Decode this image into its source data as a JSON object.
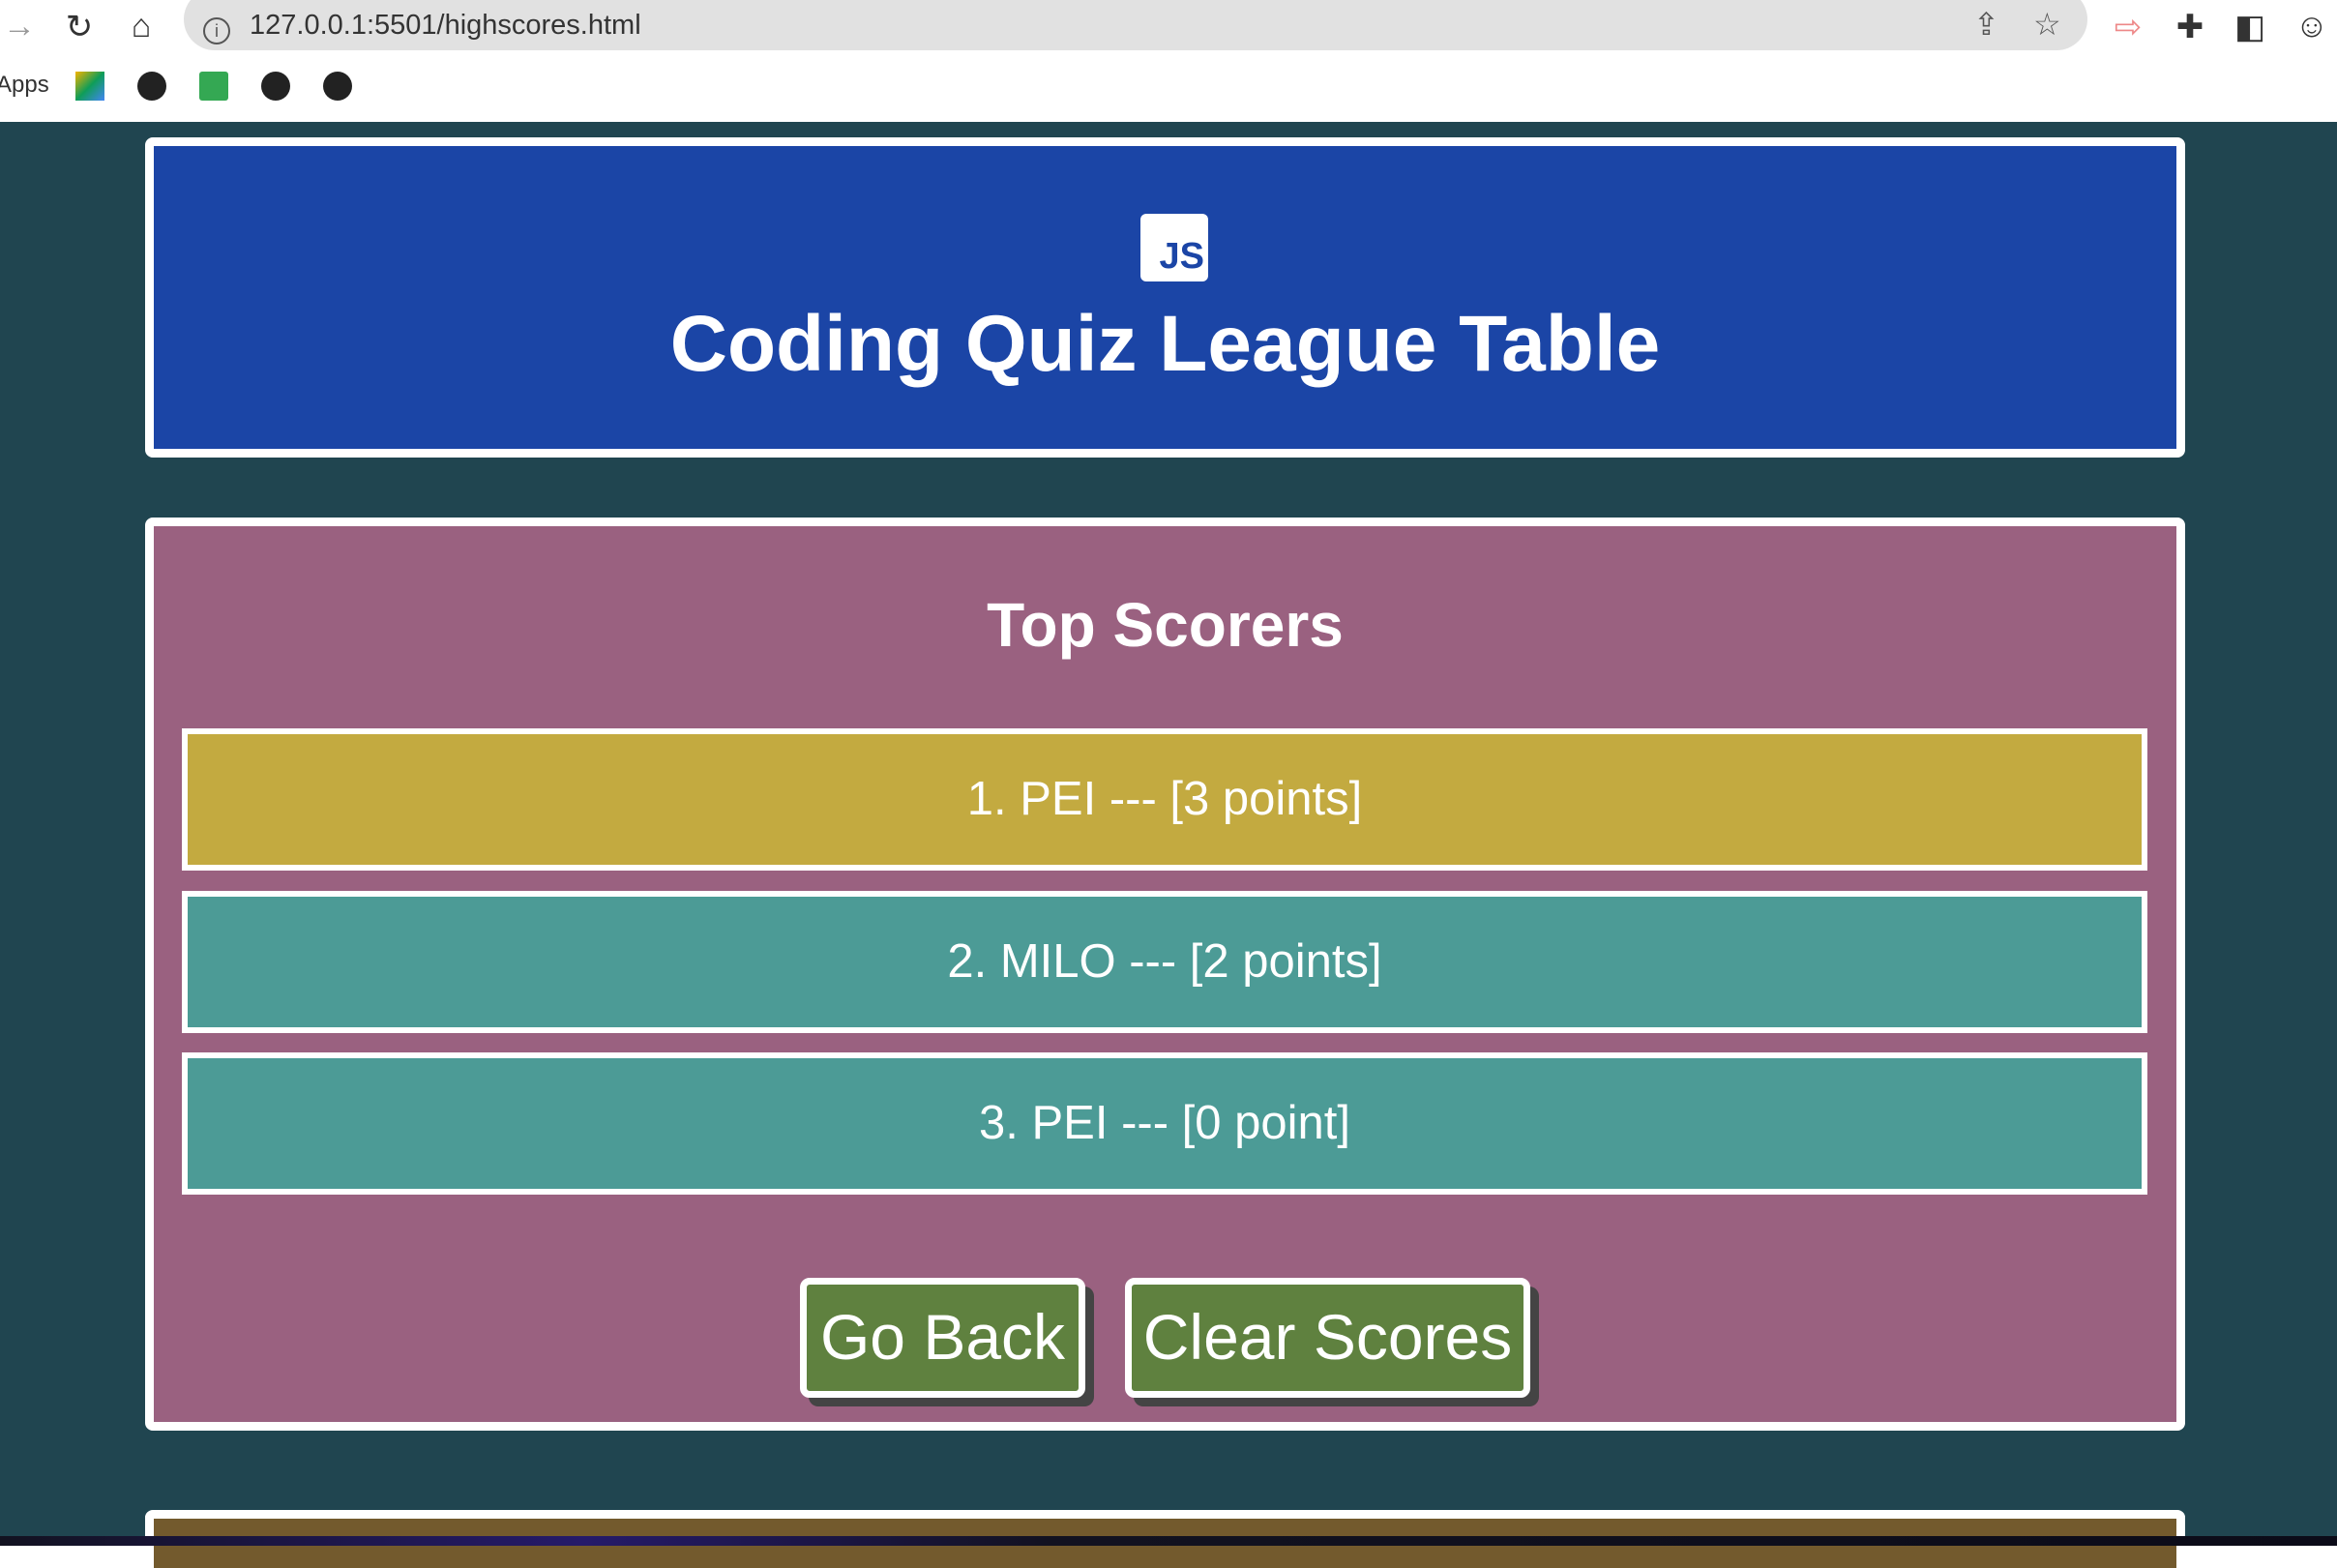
{
  "browser": {
    "url": "127.0.0.1:5501/highscores.html",
    "bookmarks_label": "Apps"
  },
  "header": {
    "logo_text": "JS",
    "title": "Coding Quiz League Table"
  },
  "scores": {
    "heading": "Top Scorers",
    "entries": [
      {
        "text": "1. PEI --- [3 points]",
        "color": "#c3aa40"
      },
      {
        "text": "2. MILO --- [2 points]",
        "color": "#4c9b96"
      },
      {
        "text": "3. PEI --- [0 point]",
        "color": "#4c9b96"
      }
    ],
    "go_back_label": "Go Back",
    "clear_label": "Clear Scores"
  },
  "colors": {
    "background": "#204550",
    "header": "#1b45a6",
    "panel": "#9a6180",
    "button": "#5f813f",
    "footer": "#735a2d"
  }
}
